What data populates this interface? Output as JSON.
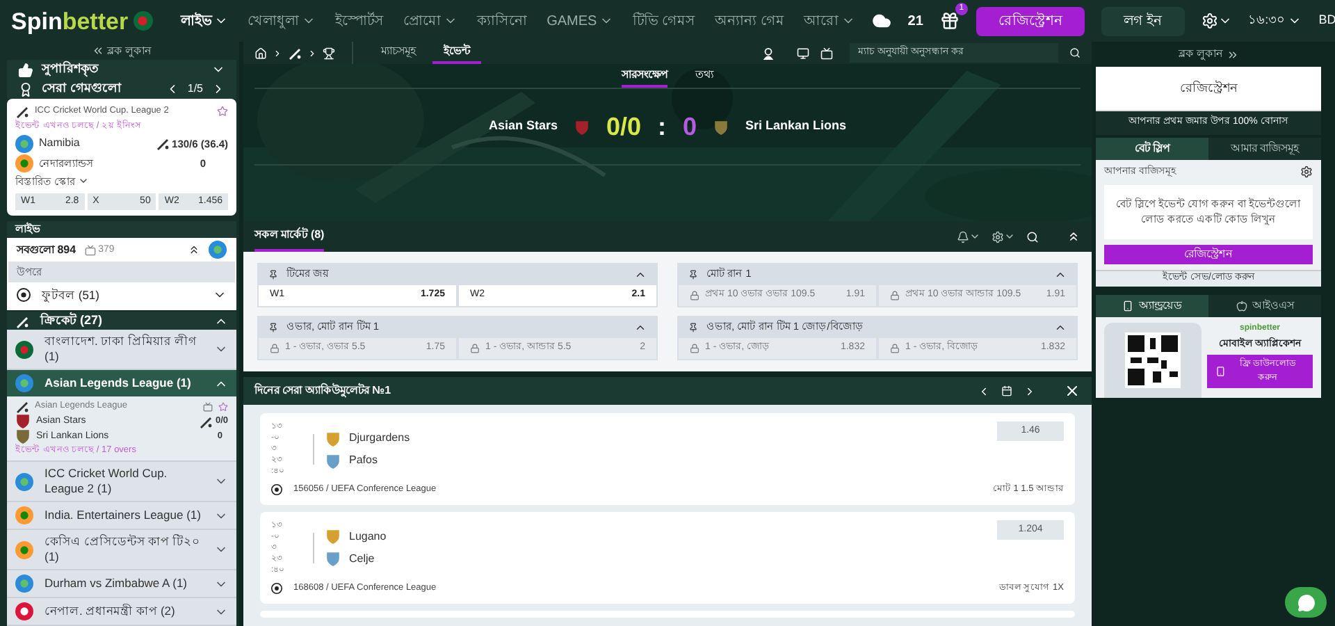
{
  "header": {
    "logo_a": "Spin",
    "logo_b": "better",
    "nav": [
      {
        "label": "লাইভ",
        "menu": true,
        "selected": true
      },
      {
        "label": "খেলাধুলা",
        "menu": true,
        "selected": false
      },
      {
        "label": "ইস্পোর্টস",
        "menu": false,
        "selected": false
      },
      {
        "label": "প্রোমো",
        "menu": true,
        "selected": false
      },
      {
        "label": "ক্যাসিনো",
        "menu": false,
        "selected": false
      },
      {
        "label": "GAMES",
        "menu": true,
        "selected": false
      },
      {
        "label": "টিভি গেমস",
        "menu": false,
        "selected": false
      },
      {
        "label": "অন্যান্য গেম",
        "menu": false,
        "selected": false
      },
      {
        "label": "আরো",
        "menu": true,
        "selected": false
      }
    ],
    "temperature": "21",
    "gift_count": "1",
    "register": "রেজিস্ট্রেশন",
    "login": "লগ ইন",
    "time": "১৬:৩০",
    "region": "BD"
  },
  "left": {
    "hide": "ব্লক লুকান",
    "recommended": "সুপারিশকৃত",
    "top_games": "সেরা গেমগুলো",
    "pager": "1/5",
    "card": {
      "league": "ICC Cricket World Cup. League 2",
      "status": "ইভেন্ট এখনও চলছে / ২য় ইনিংস",
      "team1": "Namibia",
      "team2": "নেদারল্যান্ডস",
      "score1": "130/6 (36.4)",
      "score2": "0",
      "details": "বিস্তারিত স্কোর",
      "odds": [
        {
          "label": "W1",
          "value": "2.8"
        },
        {
          "label": "X",
          "value": "50"
        },
        {
          "label": "W2",
          "value": "1.456"
        }
      ]
    },
    "live": "লাইভ",
    "all": "সবগুলো 894",
    "screens": "379",
    "top": "উপরে",
    "football": "ফুটবল (51)",
    "cricket": "ক্রিকেট (27)",
    "leagues": [
      {
        "name": "বাংলাদেশ. ঢাকা প্রিমিয়ার লীগ (1)",
        "kind": "bd",
        "expanded": false
      },
      {
        "name": "Asian Legends League (1)",
        "kind": "globe",
        "expanded": true,
        "match": {
          "league": "Asian Legends League",
          "team1": "Asian Stars",
          "team2": "Sri Lankan Lions",
          "score1": "0/0",
          "score2": "0",
          "status": "ইভেন্ট এখনও চলছে / 17 overs"
        }
      },
      {
        "name": "ICC Cricket World Cup. League 2 (1)",
        "kind": "globe",
        "expanded": false
      },
      {
        "name": "India. Entertainers League (1)",
        "kind": "in",
        "expanded": false
      },
      {
        "name": "কেসিএ প্রেসিডেন্টস কাপ টি২০ (1)",
        "kind": "in",
        "expanded": false
      },
      {
        "name": "Durham vs Zimbabwe A (1)",
        "kind": "globe",
        "expanded": false
      },
      {
        "name": "নেপাল. প্রধানমন্ত্রী কাপ (2)",
        "kind": "np",
        "expanded": false
      }
    ]
  },
  "center": {
    "tabs": [
      {
        "label": "ম্যাচসমূহ",
        "selected": false
      },
      {
        "label": "ইভেন্ট",
        "selected": true
      }
    ],
    "search": {
      "placeholder": "ম্যাচ অনুযায়ী অনুসন্ধান কর"
    },
    "subtabs": [
      {
        "label": "সারসংক্ষেপ",
        "selected": true
      },
      {
        "label": "তথ্য",
        "selected": false
      }
    ],
    "team1": "Asian Stars",
    "team2": "Sri Lankan Lions",
    "score1": "0/0",
    "separator": ":",
    "score2": "0",
    "markets_title": "সকল মার্কেট (8)",
    "markets": [
      {
        "title": "টিমের জয়",
        "outcomes": [
          {
            "label": "W1",
            "value": "1.725",
            "locked": false
          },
          {
            "label": "W2",
            "value": "2.1",
            "locked": false
          }
        ]
      },
      {
        "title": "মোট রান 1",
        "outcomes": [
          {
            "label": "প্রথম 10 ওভার ওভার 109.5",
            "value": "1.91",
            "locked": true
          },
          {
            "label": "প্রথম 10 ওভার আন্ডার 109.5",
            "value": "1.91",
            "locked": true
          }
        ]
      },
      {
        "title": "ওভার, মোট রান টিম 1",
        "outcomes": [
          {
            "label": "1 - ওভার, ওভার 5.5",
            "value": "1.75",
            "locked": true
          },
          {
            "label": "1 - ওভার, আন্ডার 5.5",
            "value": "2",
            "locked": true
          }
        ]
      },
      {
        "title": "ওভার, মোট রান টিম 1 জোড়/বিজোড়",
        "outcomes": [
          {
            "label": "1 - ওভার, জোড়",
            "value": "1.832",
            "locked": true
          },
          {
            "label": "1 - ওভার, বিজোড়",
            "value": "1.832",
            "locked": true
          }
        ]
      }
    ],
    "accumulator_title": "দিনের সেরা অ্যাকিউমুলেটর №1",
    "accumulator": [
      {
        "date": [
          "১৩",
          "-০",
          "৩",
          "২৩",
          ":৪০"
        ],
        "team1": "Djurgardens",
        "team2": "Pafos",
        "odd": "1.46",
        "league": "156056 / UEFA Conference League",
        "bet": "মোট 1 1.5 আন্ডার"
      },
      {
        "date": [
          "১৩",
          "-০",
          "৩",
          "২৩",
          ":৪০"
        ],
        "team1": "Lugano",
        "team2": "Celje",
        "odd": "1.204",
        "league": "168608 / UEFA Conference League",
        "bet": "ডাবল সুযোগ 1X"
      }
    ]
  },
  "right": {
    "hide": "ব্লক লুকান",
    "register": "রেজিস্ট্রেশন",
    "bonus": "আপনার প্রথম জমার উপর 100% বোনাস",
    "tabs": [
      {
        "label": "বেট স্লিপ",
        "selected": true
      },
      {
        "label": "আমার বাজিসমূহ",
        "selected": false
      }
    ],
    "your_bets": "আপনার বাজিসমূহ",
    "hint": "বেট স্লিপে ইভেন্ট যোগ করুন বা ইভেন্টগুলো লোড করতে একটি কোড লিখুন",
    "register2": "রেজিস্ট্রেশন",
    "save_load": "ইভেন্ট সেভ/লোড করুন",
    "app_tabs": [
      {
        "label": "অ্যান্ড্রয়েড",
        "selected": true
      },
      {
        "label": "আইওএস",
        "selected": false
      }
    ],
    "app_brand": "spinbetter",
    "app_title": "মোবাইল অ্যাপ্লিকেশন",
    "download": "ফ্রি ডাউনলোড করুন"
  }
}
